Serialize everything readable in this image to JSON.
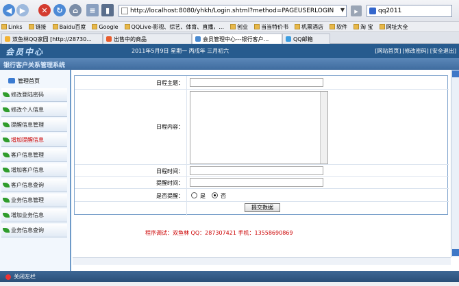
{
  "browser": {
    "url": "http://localhost:8080/yhkh/Login.shtml?method=PAGEUSERLOGIN",
    "search_value": "qq2011",
    "links": [
      "Links",
      "链接",
      "Baidu百度",
      "Google",
      "QQLive-影视、综艺、体育、直播，...",
      "创业",
      "当当特价书",
      "机票酒店",
      "软件",
      "淘 宝",
      "网址大全"
    ],
    "tabs": [
      "双鱼林QQ家园 [http://28730...",
      "出售中的商品",
      "会员管理中心---银行客户...",
      "QQ邮箱"
    ]
  },
  "header": {
    "logo": "会员中心",
    "date": "2011年5月9日 星期一 丙戌年 三月初六",
    "links": [
      "[网站首页]",
      "[修改密码]",
      "[安全退出]"
    ]
  },
  "system_title": "银行客户关系管理系统",
  "sidebar": {
    "home": "管理首页",
    "items": [
      {
        "label": "修改登陆密码"
      },
      {
        "label": "修改个人信息"
      },
      {
        "label": "提醒信息管理"
      },
      {
        "label": "增加提醒信息"
      },
      {
        "label": "客户信息管理"
      },
      {
        "label": "增加客户信息"
      },
      {
        "label": "客户信息查询"
      },
      {
        "label": "业务信息管理"
      },
      {
        "label": "增加业务信息"
      },
      {
        "label": "业务信息查询"
      }
    ]
  },
  "form": {
    "subject_label": "日程主题：",
    "content_label": "日程内容：",
    "time_label": "日程时间：",
    "remind_time_label": "提醒时间：",
    "remind_label": "是否提醒：",
    "yes": "是",
    "no": "否",
    "submit": "提交数据"
  },
  "footer": "程序调试：双鱼林 QQ：287307421 手机：13558690869",
  "bottom": {
    "close_sidebar": "关闭左栏"
  }
}
